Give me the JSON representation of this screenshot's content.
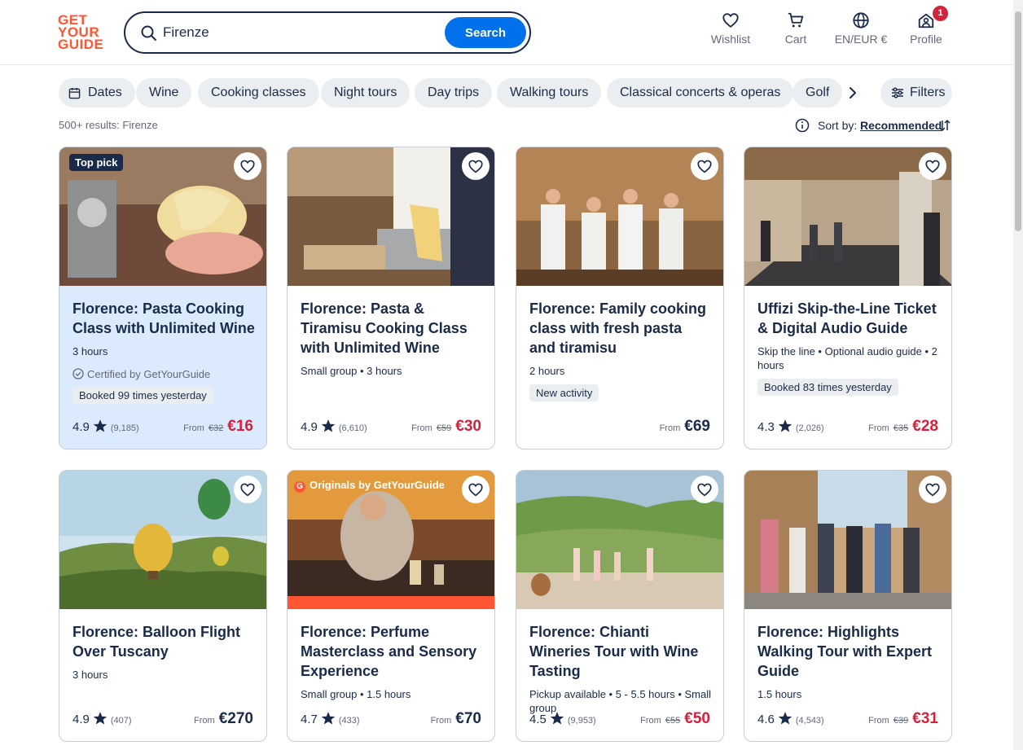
{
  "header": {
    "logo_lines": [
      "GET",
      "YOUR",
      "GUIDE"
    ],
    "search": {
      "value": "Firenze",
      "button": "Search"
    },
    "nav": {
      "wishlist": "Wishlist",
      "cart": "Cart",
      "language": "EN/EUR €",
      "profile": "Profile",
      "profile_badge": "1"
    }
  },
  "chips": [
    "Dates",
    "Wine",
    "Cooking classes",
    "Night tours",
    "Day trips",
    "Walking tours",
    "Classical concerts & operas",
    "Golf"
  ],
  "filters_label": "Filters",
  "results_text": "500+ results: Firenze",
  "sort": {
    "label": "Sort by:",
    "value": "Recommended"
  },
  "colors": {
    "brand": "#ff5533",
    "primary": "#0071eb",
    "sale": "#d4213d",
    "text": "#1a2b49",
    "chip_bg": "#ebeef1"
  },
  "cards": [
    {
      "badge": "Top pick",
      "title": "Florence: Pasta Cooking Class with Unlimited Wine",
      "meta": "3 hours",
      "certified": "Certified by GetYourGuide",
      "tag": "Booked 99 times yesterday",
      "rating": "4.9",
      "reviews": "(9,185)",
      "from": "From",
      "old_price": "€32",
      "price": "€16"
    },
    {
      "title": "Florence: Pasta & Tiramisu Cooking Class with Unlimited Wine",
      "meta": "Small group • 3 hours",
      "rating": "4.9",
      "reviews": "(6,610)",
      "from": "From",
      "old_price": "€59",
      "price": "€30"
    },
    {
      "title": "Florence: Family cooking class with fresh pasta and tiramisu",
      "meta": "2 hours",
      "tag": "New activity",
      "from": "From",
      "price": "€69"
    },
    {
      "title": "Uffizi Skip-the-Line Ticket & Digital Audio Guide",
      "meta": "Skip the line • Optional audio guide • 2 hours",
      "tag": "Booked 83 times yesterday",
      "rating": "4.3",
      "reviews": "(2,026)",
      "from": "From",
      "old_price": "€35",
      "price": "€28"
    },
    {
      "title": "Florence: Balloon Flight Over Tuscany",
      "meta": "3 hours",
      "rating": "4.9",
      "reviews": "(407)",
      "from": "From",
      "price": "€270"
    },
    {
      "badge": "Originals by GetYourGuide",
      "title": "Florence: Perfume Masterclass and Sensory Experience",
      "meta": "Small group • 1.5 hours",
      "rating": "4.7",
      "reviews": "(433)",
      "from": "From",
      "price": "€70"
    },
    {
      "title": "Florence: Chianti Wineries Tour with Wine Tasting",
      "meta": "Pickup available • 5 - 5.5 hours • Small group",
      "rating": "4.5",
      "reviews": "(9,953)",
      "from": "From",
      "old_price": "€55",
      "price": "€50"
    },
    {
      "title": "Florence: Highlights Walking Tour with Expert Guide",
      "meta": "1.5 hours",
      "rating": "4.6",
      "reviews": "(4,543)",
      "from": "From",
      "old_price": "€39",
      "price": "€31"
    }
  ]
}
